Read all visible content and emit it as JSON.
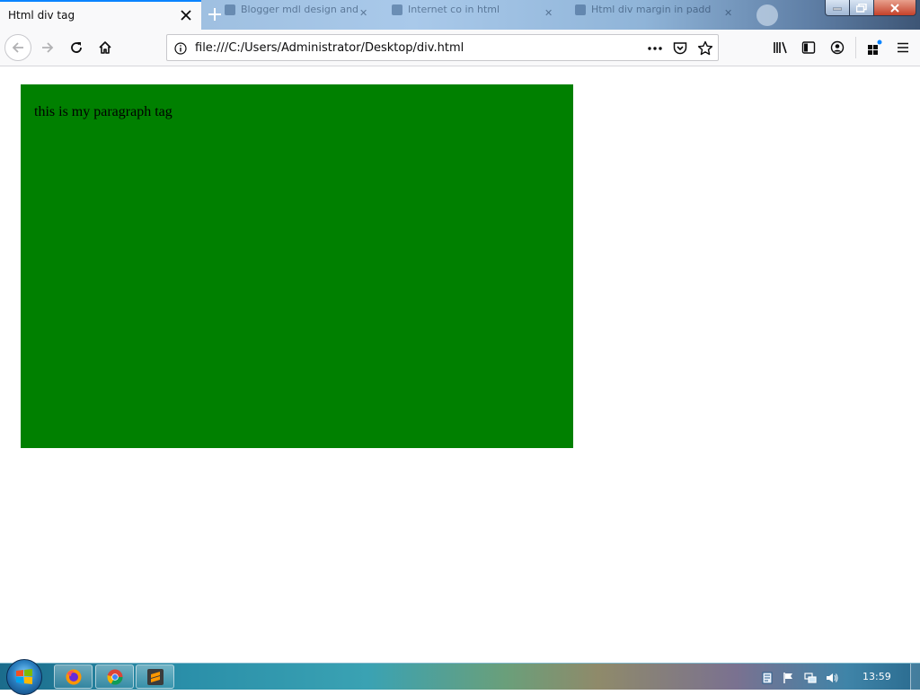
{
  "browser": {
    "active_tab_title": "Html div tag",
    "background_tabs": [
      "Blogger mdl design and",
      "Internet co in html",
      "Html div margin in padd"
    ],
    "url": "file:///C:/Users/Administrator/Desktop/div.html"
  },
  "page": {
    "box_color": "#008000",
    "paragraph": "this is my paragraph tag"
  },
  "taskbar": {
    "pinned": [
      "firefox-icon",
      "chrome-icon",
      "sublime-text-icon"
    ],
    "clock": "13:59"
  },
  "colors": {
    "accent_tab": "#0a84ff"
  }
}
